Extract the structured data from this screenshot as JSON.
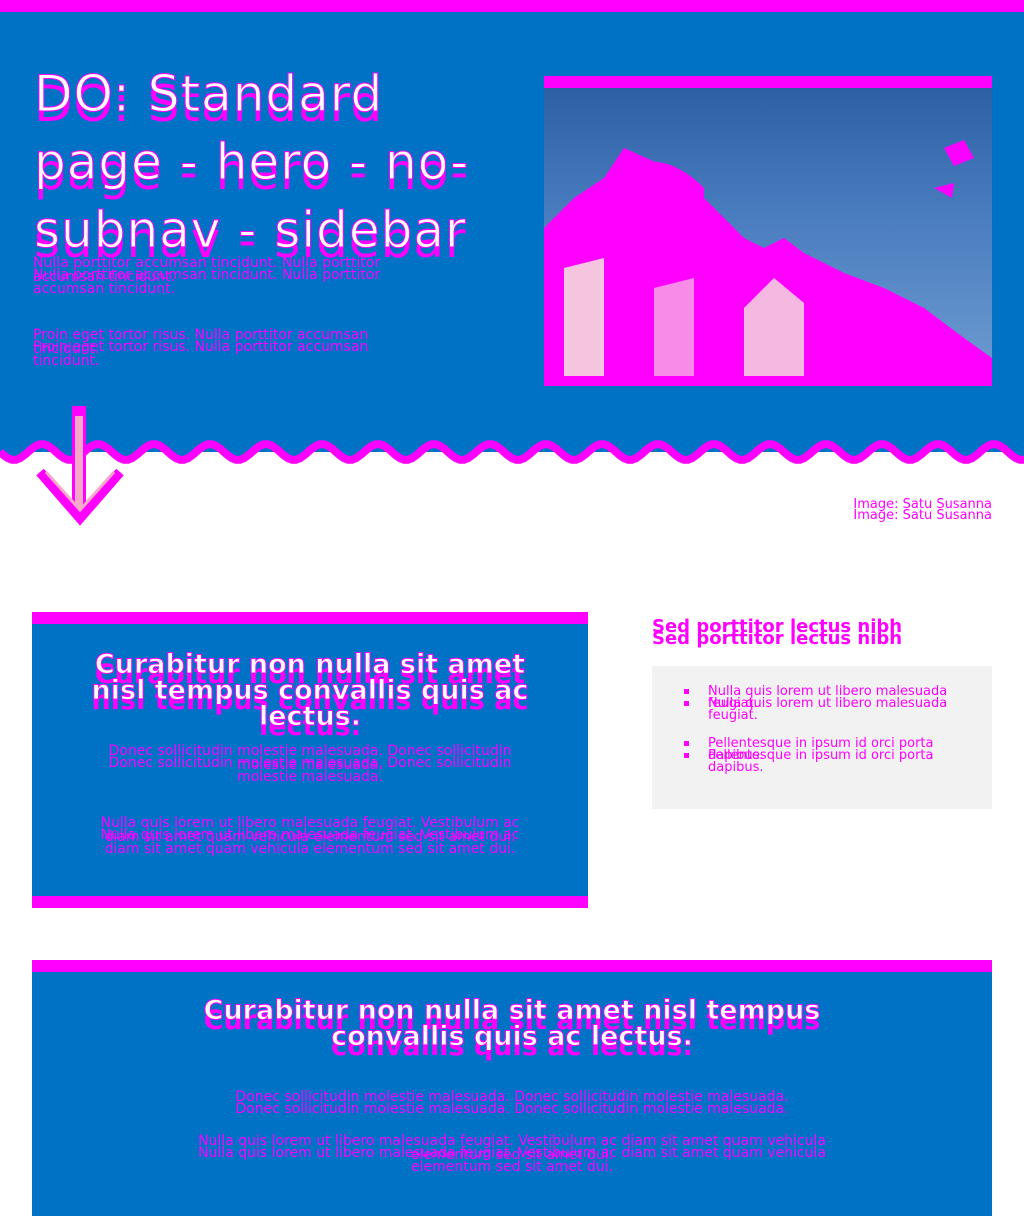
{
  "colors": {
    "accent": "#ff00ff",
    "hero_bg": "#0072c6",
    "sidebar_bg": "#f2f2f2"
  },
  "hero": {
    "title": "DO: Standard page - hero - no-subnav - sidebar",
    "paragraphs": [
      "Nulla porttitor accumsan tincidunt. Nulla porttitor accumsan tincidunt.",
      "Proin eget tortor risus. Nulla porttitor accumsan tincidunt."
    ],
    "image_credit": "Image: Satu Susanna"
  },
  "main_card": {
    "title": "Curabitur non nulla sit amet nisl tempus convallis quis ac lectus.",
    "paragraphs": [
      "Donec sollicitudin molestie malesuada. Donec sollicitudin molestie malesuada.",
      "Nulla quis lorem ut libero malesuada feugiat. Vestibulum ac diam sit amet quam vehicula elementum sed sit amet dui."
    ]
  },
  "sidebar": {
    "heading": "Sed porttitor lectus nibh",
    "items": [
      "Nulla quis lorem ut libero malesuada feugiat.",
      "Pellentesque in ipsum id orci porta dapibus."
    ]
  },
  "wide_card": {
    "title": "Curabitur non nulla sit amet nisl tempus convallis quis ac lectus.",
    "paragraphs": [
      "Donec sollicitudin molestie malesuada. Donec sollicitudin molestie malesuada.",
      "Nulla quis lorem ut libero malesuada feugiat. Vestibulum ac diam sit amet quam vehicula elementum sed sit amet dui."
    ]
  }
}
